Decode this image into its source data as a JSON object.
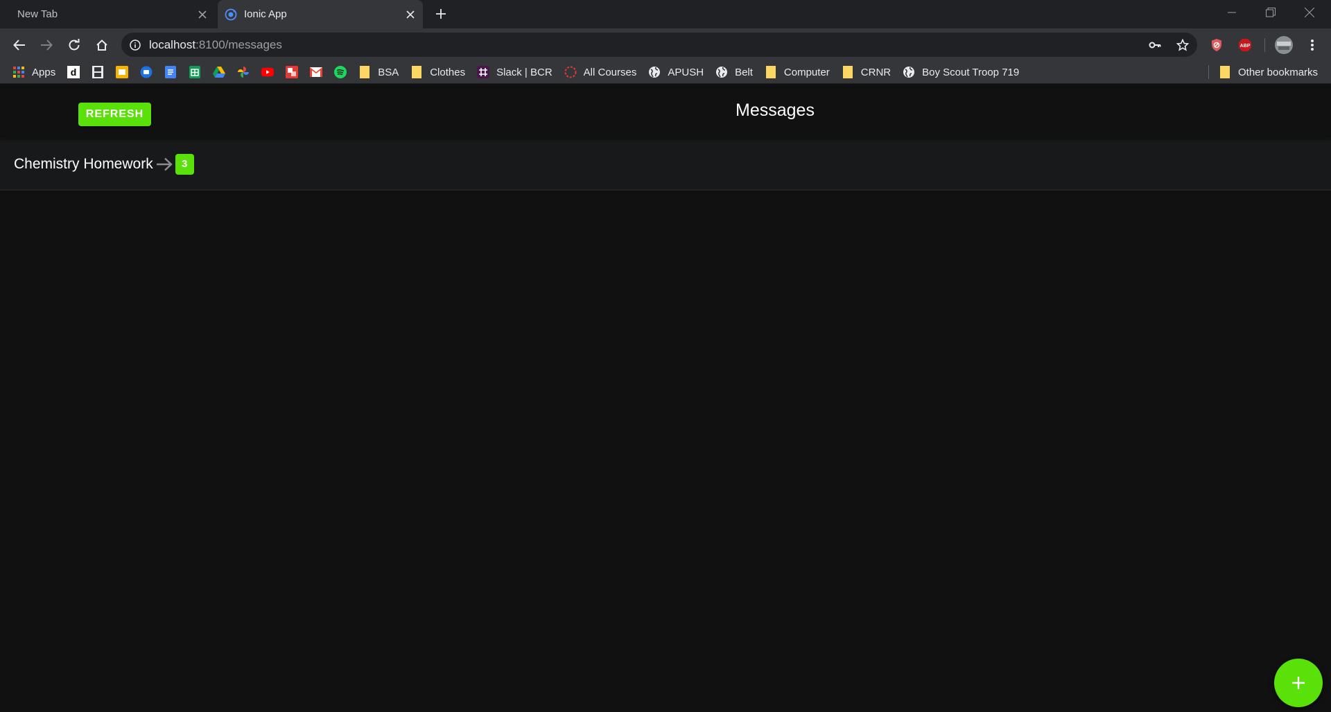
{
  "browser": {
    "tabs": [
      {
        "title": "New Tab"
      },
      {
        "title": "Ionic App"
      }
    ],
    "url": {
      "host": "localhost",
      "path": ":8100/messages"
    },
    "bookmarks": [
      {
        "label": "Apps",
        "icon": "apps-grid-icon"
      },
      {
        "label": "",
        "icon": "d-icon"
      },
      {
        "label": "",
        "icon": "film-icon"
      },
      {
        "label": "",
        "icon": "slides-icon"
      },
      {
        "label": "",
        "icon": "meet-icon"
      },
      {
        "label": "",
        "icon": "docs-icon"
      },
      {
        "label": "",
        "icon": "sheets-icon"
      },
      {
        "label": "",
        "icon": "drive-icon"
      },
      {
        "label": "",
        "icon": "photos-icon"
      },
      {
        "label": "",
        "icon": "youtube-icon"
      },
      {
        "label": "",
        "icon": "dash-icon"
      },
      {
        "label": "",
        "icon": "gmail-icon"
      },
      {
        "label": "",
        "icon": "spotify-icon"
      },
      {
        "label": "BSA",
        "icon": "folder-icon"
      },
      {
        "label": "Clothes",
        "icon": "folder-icon"
      },
      {
        "label": "Slack | BCR",
        "icon": "slack-icon"
      },
      {
        "label": "All Courses",
        "icon": "courses-icon"
      },
      {
        "label": "APUSH",
        "icon": "globe-icon"
      },
      {
        "label": "Belt",
        "icon": "globe-icon"
      },
      {
        "label": "Computer",
        "icon": "folder-icon"
      },
      {
        "label": "CRNR",
        "icon": "folder-icon"
      },
      {
        "label": "Boy Scout Troop 719",
        "icon": "globe-icon"
      }
    ],
    "other_bookmarks": "Other bookmarks"
  },
  "app": {
    "refresh_label": "REFRESH",
    "title": "Messages",
    "messages": [
      {
        "label": "Chemistry Homework",
        "count": "3"
      }
    ],
    "accent": "#5ae10a"
  }
}
